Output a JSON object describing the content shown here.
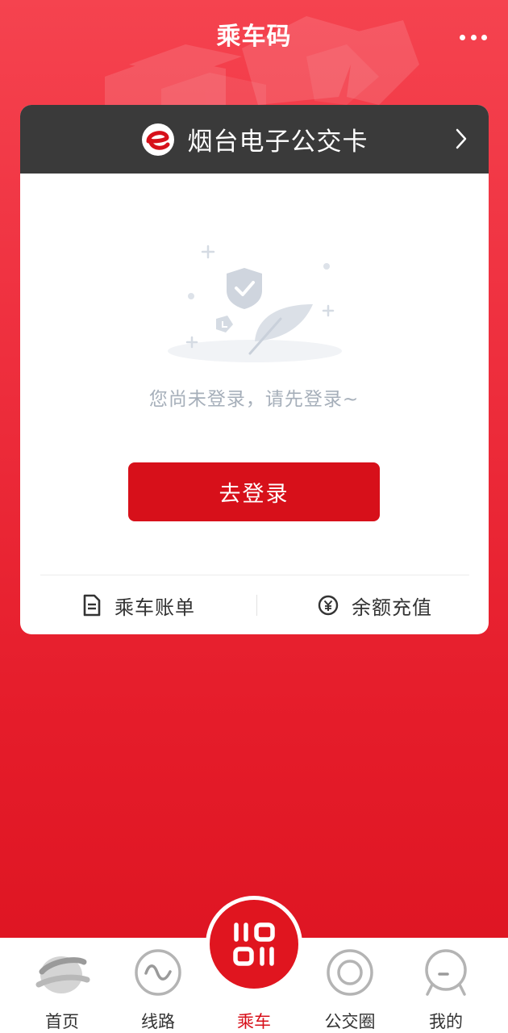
{
  "header": {
    "title": "乘车码"
  },
  "card": {
    "title": "烟台电子公交卡",
    "empty_text": "您尚未登录，请先登录~",
    "login_button": "去登录",
    "actions": [
      {
        "label": "乘车账单",
        "icon": "document-icon"
      },
      {
        "label": "余额充值",
        "icon": "yuan-circle-icon"
      }
    ]
  },
  "tabbar": {
    "items": [
      {
        "label": "首页",
        "icon": "home-globe-icon",
        "active": false
      },
      {
        "label": "线路",
        "icon": "route-wave-icon",
        "active": false
      },
      {
        "label": "乘车",
        "icon": "ride-code-icon",
        "active": true
      },
      {
        "label": "公交圈",
        "icon": "circle-icon",
        "active": false
      },
      {
        "label": "我的",
        "icon": "profile-icon",
        "active": false
      }
    ]
  },
  "colors": {
    "brand_red": "#d7101a",
    "card_header": "#3a3a3a",
    "muted_text": "#a6afba"
  }
}
